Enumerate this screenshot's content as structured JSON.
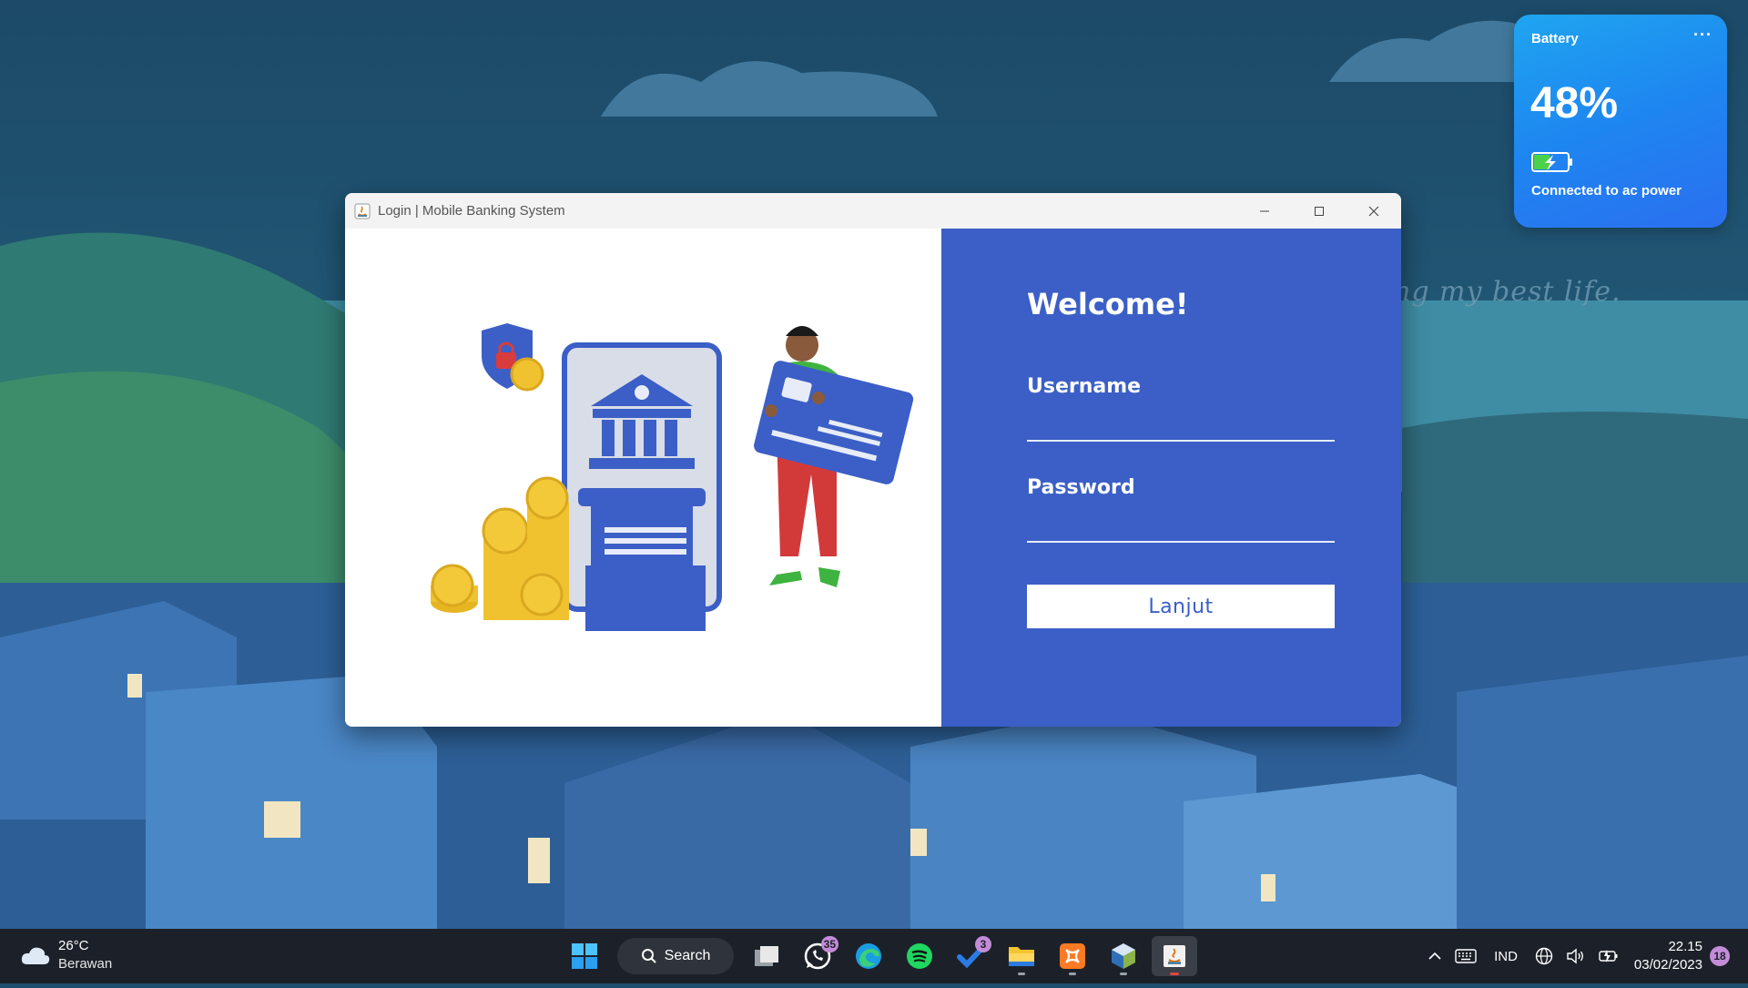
{
  "wallpaper": {
    "quote": "ng my best life."
  },
  "battery_widget": {
    "title": "Battery",
    "more": "···",
    "percent": "48%",
    "level": 0.48,
    "status": "Connected to ac power"
  },
  "window": {
    "title": "Login | Mobile Banking System",
    "controls": {
      "minimize": "minimize-icon",
      "maximize": "maximize-icon",
      "close": "close-icon"
    }
  },
  "login": {
    "welcome": "Welcome!",
    "username_label": "Username",
    "username_value": "",
    "password_label": "Password",
    "password_value": "",
    "submit_label": "Lanjut",
    "accent_color": "#3b5fc6"
  },
  "taskbar": {
    "weather": {
      "temp": "26°C",
      "condition": "Berawan"
    },
    "search_label": "Search",
    "apps": [
      {
        "name": "start",
        "icon": "windows-icon"
      },
      {
        "name": "task-view",
        "icon": "task-view-icon"
      },
      {
        "name": "whatsapp",
        "icon": "whatsapp-icon",
        "badge": "35"
      },
      {
        "name": "edge",
        "icon": "edge-icon"
      },
      {
        "name": "spotify",
        "icon": "spotify-icon"
      },
      {
        "name": "todo",
        "icon": "todo-icon",
        "badge": "3"
      },
      {
        "name": "file-explorer",
        "icon": "folder-icon"
      },
      {
        "name": "xampp",
        "icon": "xampp-icon"
      },
      {
        "name": "netbeans",
        "icon": "netbeans-icon"
      },
      {
        "name": "java",
        "icon": "java-icon"
      }
    ],
    "tray": {
      "language": "IND",
      "time": "22.15",
      "date": "03/02/2023",
      "notifications": "18"
    }
  }
}
